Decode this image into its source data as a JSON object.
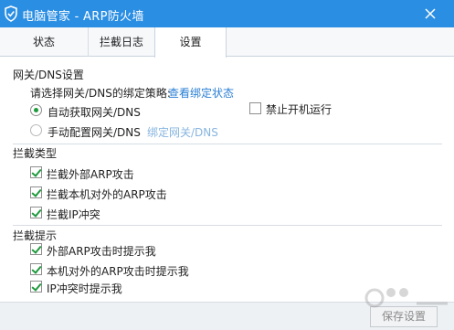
{
  "window": {
    "title": "电脑管家 - ARP防火墙",
    "logo_icon": "shield-check-icon",
    "close_icon": "close-icon",
    "title_bar_color": "#2a8ee3"
  },
  "tabs": [
    {
      "label": "状态"
    },
    {
      "label": "拦截日志"
    },
    {
      "label": "设置"
    }
  ],
  "gateway": {
    "section_title": "网关/DNS设置",
    "prompt": "请选择网关/DNS的绑定策略:",
    "view_link": "查看绑定状态",
    "auto_option": "自动获取网关/DNS",
    "manual_option": "手动配置网关/DNS",
    "bind_link": "绑定网关/DNS",
    "disable_startup": "禁止开机运行"
  },
  "block_types": {
    "section_title": "拦截类型",
    "items": [
      {
        "label": "拦截外部ARP攻击"
      },
      {
        "label": "拦截本机对外的ARP攻击"
      },
      {
        "label": "拦截IP冲突"
      }
    ]
  },
  "block_prompts": {
    "section_title": "拦截提示",
    "items": [
      {
        "label": "外部ARP攻击时提示我"
      },
      {
        "label": "本机对外的ARP攻击时提示我"
      },
      {
        "label": "IP冲突时提示我"
      }
    ]
  },
  "footer": {
    "save_button": "保存设置"
  },
  "accent_colors": {
    "link": "#2a7fd4",
    "check_green": "#1e9a3c"
  }
}
